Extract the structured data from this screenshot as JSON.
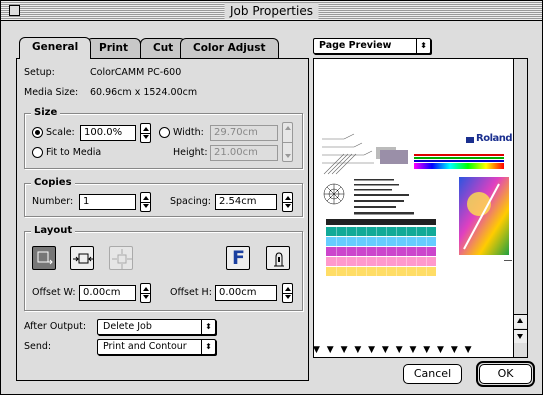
{
  "window": {
    "title": "Job Properties"
  },
  "tabs": [
    {
      "label": "General",
      "active": true
    },
    {
      "label": "Print",
      "active": false
    },
    {
      "label": "Cut",
      "active": false
    },
    {
      "label": "Color Adjust",
      "active": false
    }
  ],
  "general": {
    "setup_label": "Setup:",
    "setup_value": "ColorCAMM PC-600",
    "media_label": "Media Size:",
    "media_value": "60.96cm x 1524.00cm",
    "size": {
      "title": "Size",
      "scale_label": "Scale:",
      "scale_value": "100.0%",
      "width_label": "Width:",
      "width_value": "29.70cm",
      "height_label": "Height:",
      "height_value": "21.00cm",
      "fit_label": "Fit to Media"
    },
    "copies": {
      "title": "Copies",
      "number_label": "Number:",
      "number_value": "1",
      "spacing_label": "Spacing:",
      "spacing_value": "2.54cm"
    },
    "layout": {
      "title": "Layout",
      "offset_w_label": "Offset W:",
      "offset_w_value": "0.00cm",
      "offset_h_label": "Offset H:",
      "offset_h_value": "0.00cm",
      "f_glyph": "F"
    },
    "after_output_label": "After Output:",
    "after_output_value": "Delete Job",
    "send_label": "Send:",
    "send_value": "Print and Contour"
  },
  "preview": {
    "popup_value": "Page Preview",
    "brand_text": "Roland",
    "triangles": "▼ ▼ ▼ ▼ ▼ ▼ ▼ ▼ ▼ ▼ ▼ ▼"
  },
  "buttons": {
    "cancel": "Cancel",
    "ok": "OK"
  },
  "colors": {
    "brand": "#1a2f8f",
    "window_bg": "#dddddd"
  }
}
